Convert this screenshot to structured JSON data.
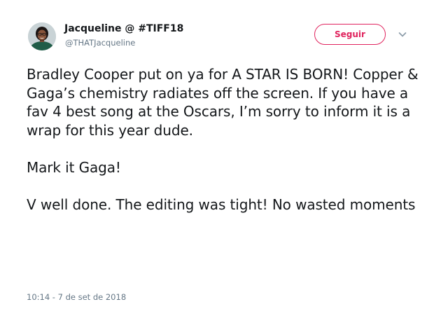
{
  "user": {
    "display_name": "Jacqueline @ #TIFF18",
    "handle": "@THATJacqueline",
    "avatar_icon": "profile-photo"
  },
  "follow_button": {
    "label": "Seguir",
    "color": "#e0245e"
  },
  "menu": {
    "icon": "chevron-down-icon"
  },
  "tweet": {
    "paragraphs": [
      "Bradley Cooper put on ya for A STAR IS BORN! Copper & Gaga’s chemistry radiates off the screen. If you have a fav 4 best song at the Oscars, I’m sorry to inform it is a wrap for this year dude.",
      "Mark it Gaga!",
      "V well done. The editing was tight! No wasted moments"
    ],
    "timestamp": "10:14 - 7 de set de 2018"
  }
}
